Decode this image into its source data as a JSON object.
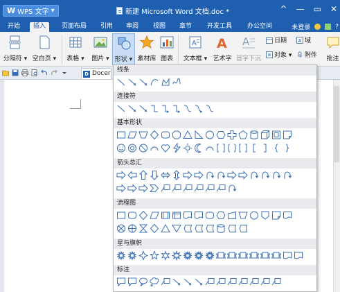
{
  "titlebar": {
    "app_label": "WPS 文字",
    "doc_title": "新建 Microsoft Word 文档.doc *",
    "controls": [
      "^",
      "—",
      "▭",
      "✕"
    ]
  },
  "menu": {
    "tabs": [
      "开始",
      "插入",
      "页面布局",
      "引用",
      "审阅",
      "视图",
      "章节",
      "开发工具",
      "办公空间"
    ],
    "active_tab": "插入",
    "login": "未登录",
    "help": "?"
  },
  "ribbon": {
    "page_break": "分隔符 ▾",
    "blank_page": "空白页 ▾",
    "table": "表格 ▾",
    "picture": "图片 ▾",
    "shapes": "形状 ▾",
    "material": "素材库",
    "chart": "图表",
    "textbox": "文本框 ▾",
    "wordart": "艺术字",
    "dropcap": "首字下沉",
    "date": "日期",
    "field": "域",
    "object": "对象 ▾",
    "attachment": "附件",
    "comment": "批注"
  },
  "docbar": {
    "doc_tab": "Docer"
  },
  "shapes_panel": {
    "sections": [
      {
        "title": "线条",
        "rows": [
          [
            "line",
            "arrow-line",
            "double-arrow-line",
            "curve",
            "freeform",
            "scribble"
          ]
        ]
      },
      {
        "title": "连接符",
        "rows": [
          [
            "conn-straight",
            "conn-arrow",
            "conn-double",
            "elbow",
            "elbow-arrow",
            "elbow-double",
            "curved-conn",
            "curved-arrow",
            "curved-double"
          ]
        ]
      },
      {
        "title": "基本形状",
        "rows": [
          [
            "rect",
            "parallelogram",
            "trapezoid",
            "diamond",
            "rounded-rect",
            "octagon",
            "triangle",
            "right-triangle",
            "oval",
            "hexagon",
            "cross",
            "pentagon",
            "can",
            "cube",
            "bevel",
            "folded-corner"
          ],
          [
            "smiley",
            "donut",
            "no-symbol",
            "block-arc",
            "heart",
            "lightning",
            "sun",
            "moon",
            "arc",
            "double-bracket",
            "double-brace",
            "plaque",
            "left-bracket",
            "right-bracket",
            "left-brace",
            "right-brace"
          ]
        ]
      },
      {
        "title": "箭头总汇",
        "rows": [
          [
            "right-arrow",
            "left-arrow",
            "up-arrow",
            "down-arrow",
            "left-right-arrow",
            "up-down-arrow",
            "quad-arrow",
            "left-right-up-arrow",
            "bent-arrow",
            "u-turn-arrow",
            "left-up-arrow",
            "bent-up-arrow",
            "curved-right-arrow",
            "curved-left-arrow",
            "curved-up-arrow",
            "curved-down-arrow"
          ],
          [
            "striped-right-arrow",
            "notched-right-arrow",
            "pentagon-arrow",
            "chevron",
            "right-arrow-callout",
            "left-arrow-callout",
            "up-arrow-callout",
            "down-arrow-callout",
            "left-right-arrow-callout",
            "quad-arrow-callout",
            "circular-arrow"
          ]
        ]
      },
      {
        "title": "流程图",
        "rows": [
          [
            "process",
            "alternate-process",
            "decision",
            "data",
            "predefined-process",
            "internal-storage",
            "document",
            "multidocument",
            "terminator",
            "preparation",
            "manual-input",
            "manual-operation",
            "connector",
            "offpage-connector",
            "card",
            "punched-tape"
          ],
          [
            "summing-junction",
            "or",
            "collate",
            "sort",
            "extract",
            "merge",
            "stored-data",
            "delay",
            "sequential-storage",
            "magnetic-disk",
            "direct-storage",
            "display"
          ]
        ]
      },
      {
        "title": "星与旗帜",
        "rows": [
          [
            "explosion1",
            "explosion2",
            "star4",
            "star5",
            "star6",
            "star8",
            "star16",
            "star24",
            "star32",
            "ribbon-up",
            "ribbon-down",
            "curved-ribbon-up",
            "curved-ribbon-down",
            "vertical-scroll",
            "horizontal-scroll",
            "wave",
            "double-wave"
          ]
        ]
      },
      {
        "title": "标注",
        "rows": [
          [
            "rect-callout",
            "rounded-rect-callout",
            "oval-callout",
            "cloud-callout",
            "line-callout1",
            "line-callout2",
            "line-callout3",
            "line-callout4",
            "accent-callout1",
            "accent-callout2",
            "accent-callout3",
            "border-callout1",
            "border-callout2",
            "border-callout3",
            "accent-border-callout"
          ]
        ]
      }
    ]
  },
  "colors": {
    "title_blue": "#1e5fb0",
    "shape_stroke": "#3a6fb5",
    "shapes_button_active": "#c9def5"
  }
}
